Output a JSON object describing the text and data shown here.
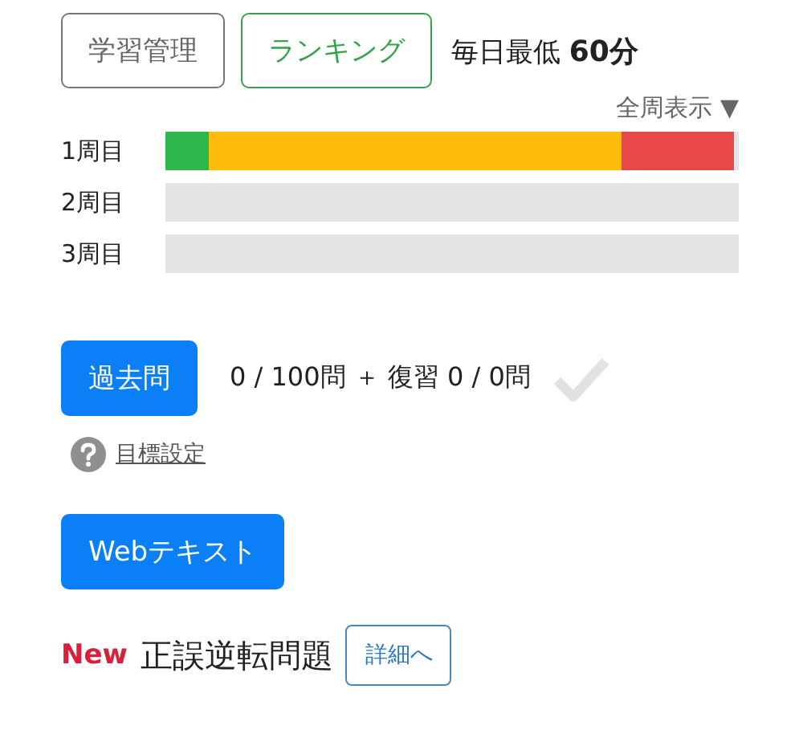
{
  "top_buttons": [
    {
      "label": "学習管理",
      "kind": "gray"
    },
    {
      "label": "ランキング",
      "kind": "green"
    }
  ],
  "daily_minimum": {
    "label": "毎日最低",
    "value": "60分"
  },
  "show_all": {
    "label": "全周表示",
    "caret": "▼"
  },
  "rounds": [
    {
      "label": "1周目",
      "segments": [
        {
          "level": 0.076,
          "color": "#2db84b"
        },
        {
          "level": 0.796,
          "color": "#fdbb0a"
        },
        {
          "level": 0.992,
          "color": "#e84848"
        }
      ]
    },
    {
      "label": "2周目"
    },
    {
      "label": "3周目"
    }
  ],
  "past_exams": {
    "button": "過去問",
    "progress": "0 / 100問 ＋ 復習 0 / 0問",
    "completed": false
  },
  "goal_link": {
    "label": "目標設定"
  },
  "web_text_button": "Webテキスト",
  "new_item": {
    "badge": "New",
    "title": "正誤逆転問題",
    "detail_button": "詳細へ"
  }
}
